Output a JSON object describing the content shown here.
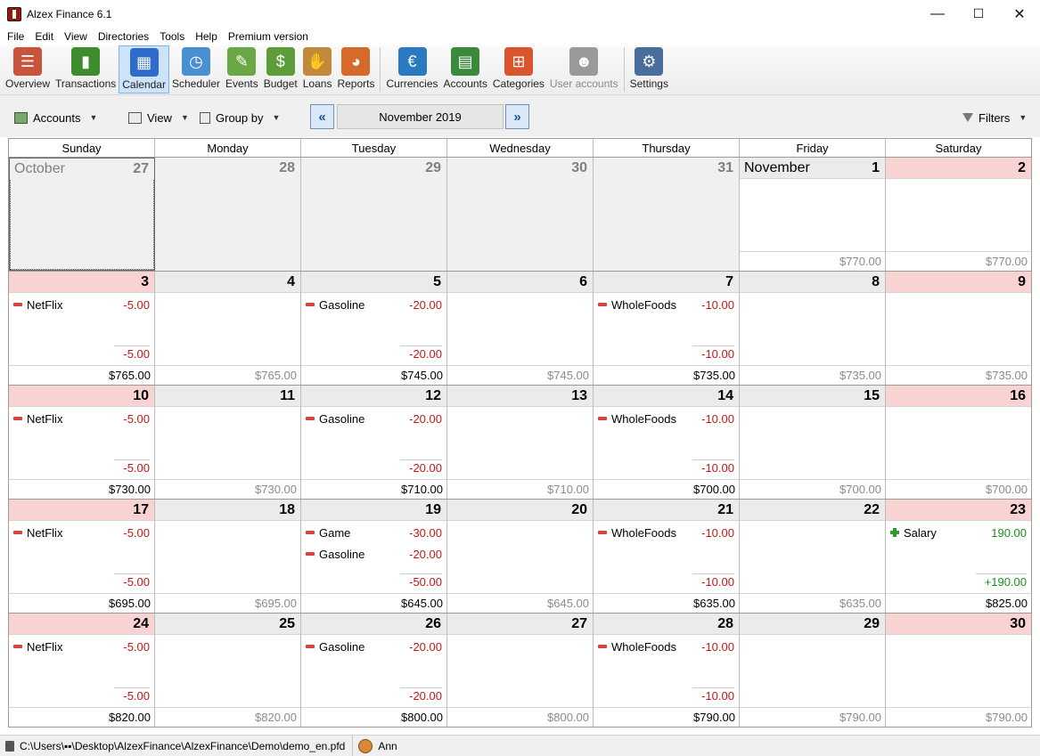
{
  "window": {
    "title": "Alzex Finance 6.1",
    "minimize": "—",
    "maximize": "☐",
    "close": "✕"
  },
  "menu": [
    "File",
    "Edit",
    "View",
    "Directories",
    "Tools",
    "Help",
    "Premium version"
  ],
  "toolbar": [
    {
      "label": "Overview",
      "icon": "overview-icon",
      "color": "#c9543c",
      "glyph": "☰"
    },
    {
      "label": "Transactions",
      "icon": "transactions-icon",
      "color": "#3e8c2c",
      "glyph": "▮"
    },
    {
      "label": "Calendar",
      "icon": "calendar-icon",
      "color": "#2f6cc9",
      "glyph": "▦",
      "active": true
    },
    {
      "label": "Scheduler",
      "icon": "scheduler-icon",
      "color": "#4b8fd3",
      "glyph": "◷"
    },
    {
      "label": "Events",
      "icon": "events-icon",
      "color": "#6aa846",
      "glyph": "✎"
    },
    {
      "label": "Budget",
      "icon": "budget-icon",
      "color": "#5c9d3a",
      "glyph": "$"
    },
    {
      "label": "Loans",
      "icon": "loans-icon",
      "color": "#c08a3a",
      "glyph": "✋"
    },
    {
      "label": "Reports",
      "icon": "reports-icon",
      "color": "#d66a2a",
      "glyph": "◕"
    },
    {
      "sep": true
    },
    {
      "label": "Currencies",
      "icon": "currencies-icon",
      "color": "#2a7ac2",
      "glyph": "€"
    },
    {
      "label": "Accounts",
      "icon": "accounts-icon",
      "color": "#3b8a3b",
      "glyph": "▤"
    },
    {
      "label": "Categories",
      "icon": "categories-icon",
      "color": "#d9552c",
      "glyph": "⊞"
    },
    {
      "label": "User accounts",
      "icon": "user-accounts-icon",
      "color": "#9a9a9a",
      "glyph": "☻",
      "disabled": true
    },
    {
      "sep": true
    },
    {
      "label": "Settings",
      "icon": "settings-icon",
      "color": "#4a6e9a",
      "glyph": "⚙"
    }
  ],
  "subbar": {
    "accounts": "Accounts",
    "view": "View",
    "group_by": "Group by",
    "prev": "«",
    "next": "»",
    "month": "November 2019",
    "filters": "Filters"
  },
  "weekdays": [
    "Sunday",
    "Monday",
    "Tuesday",
    "Wednesday",
    "Thursday",
    "Friday",
    "Saturday"
  ],
  "weeks": [
    [
      {
        "num": "27",
        "month": "October",
        "other": true,
        "selected": true
      },
      {
        "num": "28",
        "other": true
      },
      {
        "num": "29",
        "other": true
      },
      {
        "num": "30",
        "other": true
      },
      {
        "num": "31",
        "other": true
      },
      {
        "num": "1",
        "month": "November",
        "balance": "$770.00",
        "balance_gray": true
      },
      {
        "num": "2",
        "weekend": true,
        "balance": "$770.00",
        "balance_gray": true
      }
    ],
    [
      {
        "num": "3",
        "weekend": true,
        "tx": [
          {
            "name": "NetFlix",
            "amount": "-5.00"
          }
        ],
        "total": "-5.00",
        "balance": "$765.00"
      },
      {
        "num": "4",
        "balance": "$765.00",
        "balance_gray": true
      },
      {
        "num": "5",
        "tx": [
          {
            "name": "Gasoline",
            "amount": "-20.00"
          }
        ],
        "total": "-20.00",
        "balance": "$745.00"
      },
      {
        "num": "6",
        "balance": "$745.00",
        "balance_gray": true
      },
      {
        "num": "7",
        "tx": [
          {
            "name": "WholeFoods",
            "amount": "-10.00"
          }
        ],
        "total": "-10.00",
        "balance": "$735.00"
      },
      {
        "num": "8",
        "balance": "$735.00",
        "balance_gray": true
      },
      {
        "num": "9",
        "weekend": true,
        "balance": "$735.00",
        "balance_gray": true
      }
    ],
    [
      {
        "num": "10",
        "weekend": true,
        "tx": [
          {
            "name": "NetFlix",
            "amount": "-5.00"
          }
        ],
        "total": "-5.00",
        "balance": "$730.00"
      },
      {
        "num": "11",
        "balance": "$730.00",
        "balance_gray": true
      },
      {
        "num": "12",
        "tx": [
          {
            "name": "Gasoline",
            "amount": "-20.00"
          }
        ],
        "total": "-20.00",
        "balance": "$710.00"
      },
      {
        "num": "13",
        "balance": "$710.00",
        "balance_gray": true
      },
      {
        "num": "14",
        "tx": [
          {
            "name": "WholeFoods",
            "amount": "-10.00"
          }
        ],
        "total": "-10.00",
        "balance": "$700.00"
      },
      {
        "num": "15",
        "balance": "$700.00",
        "balance_gray": true
      },
      {
        "num": "16",
        "weekend": true,
        "balance": "$700.00",
        "balance_gray": true
      }
    ],
    [
      {
        "num": "17",
        "weekend": true,
        "tx": [
          {
            "name": "NetFlix",
            "amount": "-5.00"
          }
        ],
        "total": "-5.00",
        "balance": "$695.00"
      },
      {
        "num": "18",
        "balance": "$695.00",
        "balance_gray": true
      },
      {
        "num": "19",
        "tx": [
          {
            "name": "Game",
            "amount": "-30.00"
          },
          {
            "name": "Gasoline",
            "amount": "-20.00"
          }
        ],
        "total": "-50.00",
        "balance": "$645.00"
      },
      {
        "num": "20",
        "balance": "$645.00",
        "balance_gray": true
      },
      {
        "num": "21",
        "tx": [
          {
            "name": "WholeFoods",
            "amount": "-10.00"
          }
        ],
        "total": "-10.00",
        "balance": "$635.00"
      },
      {
        "num": "22",
        "balance": "$635.00",
        "balance_gray": true
      },
      {
        "num": "23",
        "weekend": true,
        "tx": [
          {
            "name": "Salary",
            "amount": "190.00",
            "income": true
          }
        ],
        "total": "+190.00",
        "total_pos": true,
        "balance": "$825.00"
      }
    ],
    [
      {
        "num": "24",
        "weekend": true,
        "tx": [
          {
            "name": "NetFlix",
            "amount": "-5.00"
          }
        ],
        "total": "-5.00",
        "balance": "$820.00"
      },
      {
        "num": "25",
        "balance": "$820.00",
        "balance_gray": true
      },
      {
        "num": "26",
        "tx": [
          {
            "name": "Gasoline",
            "amount": "-20.00"
          }
        ],
        "total": "-20.00",
        "balance": "$800.00"
      },
      {
        "num": "27",
        "balance": "$800.00",
        "balance_gray": true
      },
      {
        "num": "28",
        "tx": [
          {
            "name": "WholeFoods",
            "amount": "-10.00"
          }
        ],
        "total": "-10.00",
        "balance": "$790.00"
      },
      {
        "num": "29",
        "balance": "$790.00",
        "balance_gray": true
      },
      {
        "num": "30",
        "weekend": true,
        "balance": "$790.00",
        "balance_gray": true
      }
    ]
  ],
  "status": {
    "path": "C:\\Users\\▪▪\\Desktop\\AlzexFinance\\AlzexFinance\\Demo\\demo_en.pfd",
    "user": "Ann"
  }
}
